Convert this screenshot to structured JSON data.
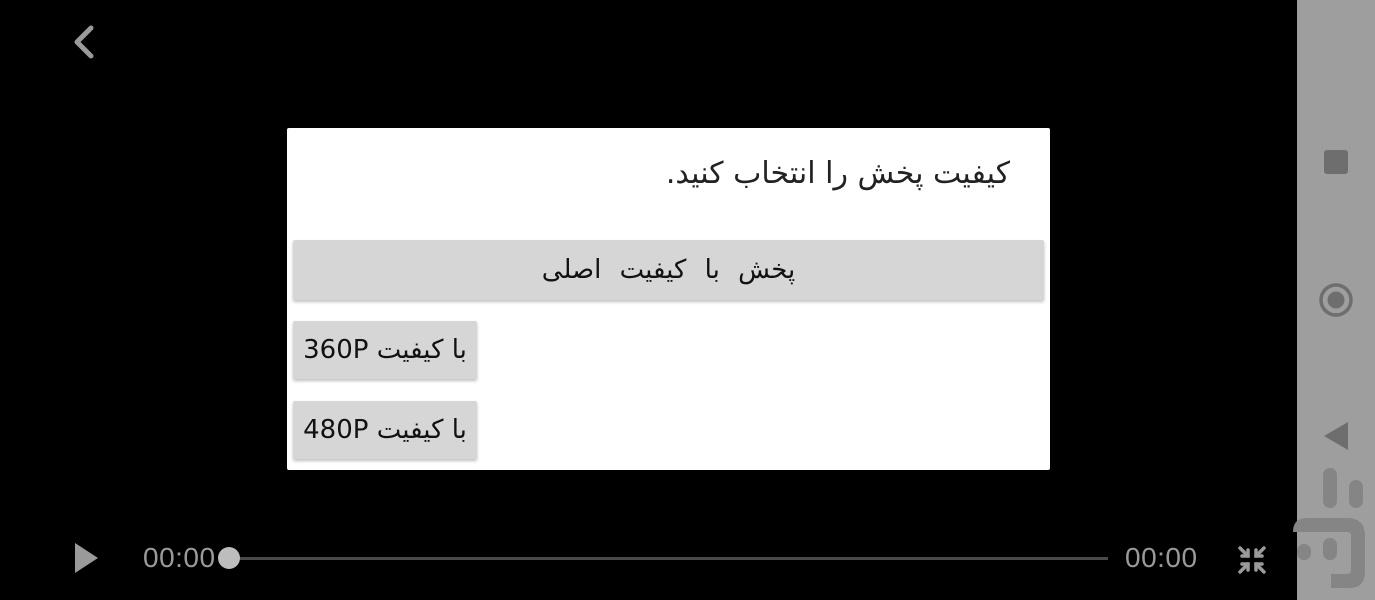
{
  "player": {
    "back_icon": "chevron-left-icon",
    "play_icon": "play-icon",
    "current_time": "00:00",
    "total_time": "00:00",
    "progress": 0,
    "fullscreen_icon": "exit-fullscreen-icon"
  },
  "dialog": {
    "title": "کیفیت پخش را انتخاب کنید.",
    "options": [
      {
        "label": "پخش با کیفیت اصلی"
      },
      {
        "label": "با کیفیت 360P"
      },
      {
        "label": "با کیفیت 480P"
      }
    ]
  },
  "navbar": {
    "recents_icon": "square-icon",
    "home_icon": "circle-icon",
    "back_icon": "triangle-back-icon",
    "watermark": "cafebazaar-logo"
  },
  "colors": {
    "background": "#000000",
    "dialog_bg": "#ffffff",
    "button_bg": "#d6d6d6",
    "navbar_bg": "#9e9e9e",
    "control_gray": "#9a9a9a"
  }
}
